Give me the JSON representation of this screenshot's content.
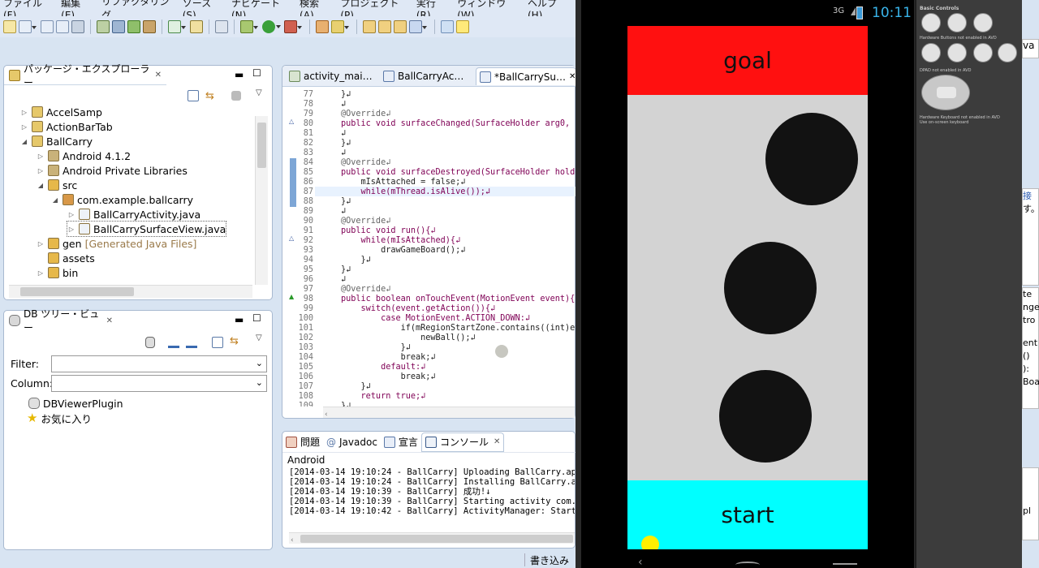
{
  "menu": [
    "ファイル(F)",
    "編集(E)",
    "リファクタリング",
    "ソース(S)",
    "ナビゲート(N)",
    "検索(A)",
    "プロジェクト(P)",
    "実行(R)",
    "ウィンドウ(W)",
    "ヘルプ(H)"
  ],
  "package_explorer": {
    "title": "パッケージ・エクスプローラー",
    "items": [
      {
        "label": "AccelSamp",
        "twisty": "▷"
      },
      {
        "label": "ActionBarTab",
        "twisty": "▷"
      },
      {
        "label": "BallCarry",
        "twisty": "◢"
      },
      {
        "label": "Android 4.1.2",
        "twisty": "▷"
      },
      {
        "label": "Android Private Libraries",
        "twisty": "▷"
      },
      {
        "label": "src",
        "twisty": "◢"
      },
      {
        "label": "com.example.ballcarry",
        "twisty": "◢"
      },
      {
        "label": "BallCarryActivity.java",
        "twisty": "▷"
      },
      {
        "label": "BallCarrySurfaceView.java",
        "twisty": "▷"
      },
      {
        "label": "gen",
        "twisty": "▷",
        "suffix": "[Generated Java Files]"
      },
      {
        "label": "assets",
        "twisty": ""
      },
      {
        "label": "bin",
        "twisty": "▷"
      }
    ]
  },
  "db_tree": {
    "title": "DB ツリー・ビュー",
    "filter_label": "Filter:",
    "column_label": "Column:",
    "items": [
      "DBViewerPlugin",
      "お気に入り"
    ]
  },
  "editor": {
    "tabs": [
      "activity_mai…",
      "BallCarryAc…",
      "*BallCarrySu…"
    ],
    "lines": [
      {
        "n": "77",
        "t": "}↲"
      },
      {
        "n": "78",
        "t": "↲"
      },
      {
        "n": "79",
        "t": "@Override↲"
      },
      {
        "n": "80",
        "t": "public void surfaceChanged(SurfaceHolder arg0, i"
      },
      {
        "n": "81",
        "t": "↲"
      },
      {
        "n": "82",
        "t": "}↲"
      },
      {
        "n": "83",
        "t": "↲"
      },
      {
        "n": "84",
        "t": "@Override↲"
      },
      {
        "n": "85",
        "t": "public void surfaceDestroyed(SurfaceHolder holde"
      },
      {
        "n": "86",
        "t": "    mIsAttached = false;↲"
      },
      {
        "n": "87",
        "t": "    while(mThread.isAlive());↲"
      },
      {
        "n": "88",
        "t": "}↲"
      },
      {
        "n": "89",
        "t": "↲"
      },
      {
        "n": "90",
        "t": "@Override↲"
      },
      {
        "n": "91",
        "t": "public void run(){↲"
      },
      {
        "n": "92",
        "t": "    while(mIsAttached){↲"
      },
      {
        "n": "93",
        "t": "        drawGameBoard();↲"
      },
      {
        "n": "94",
        "t": "    }↲"
      },
      {
        "n": "95",
        "t": "}↲"
      },
      {
        "n": "96",
        "t": "↲"
      },
      {
        "n": "97",
        "t": "@Override↲"
      },
      {
        "n": "98",
        "t": "public boolean onTouchEvent(MotionEvent event){↲"
      },
      {
        "n": "99",
        "t": "    switch(event.getAction()){↲"
      },
      {
        "n": "100",
        "t": "        case MotionEvent.ACTION_DOWN:↲"
      },
      {
        "n": "101",
        "t": "            if(mRegionStartZone.contains((int)ev"
      },
      {
        "n": "102",
        "t": "                newBall();↲"
      },
      {
        "n": "103",
        "t": "            }↲"
      },
      {
        "n": "104",
        "t": "            break;↲"
      },
      {
        "n": "105",
        "t": "        default:↲"
      },
      {
        "n": "106",
        "t": "            break;↲"
      },
      {
        "n": "107",
        "t": "    }↲"
      },
      {
        "n": "108",
        "t": "    return true;↲"
      },
      {
        "n": "109",
        "t": "}↲"
      }
    ]
  },
  "bottom_tabs": [
    "問題",
    "Javadoc",
    "宣言",
    "コンソール"
  ],
  "console": {
    "title": "Android",
    "lines": [
      "[2014-03-14 19:10:24 - BallCarry] Uploading BallCarry.apk o",
      "[2014-03-14 19:10:24 - BallCarry] Installing BallCarry.apk.",
      "[2014-03-14 19:10:39 - BallCarry] 成功!↓",
      "[2014-03-14 19:10:39 - BallCarry] Starting activity com.exa",
      "[2014-03-14 19:10:42 - BallCarry] ActivityManager: Starting"
    ]
  },
  "status_right": "書き込み可",
  "emulator": {
    "time": "10:11",
    "network": "3G",
    "goal_label": "goal",
    "start_label": "start",
    "goal_color": "#ff1010",
    "start_color": "#00ffff",
    "board_color": "#d3d3d3",
    "controls": {
      "basic": "Basic Controls",
      "hw_buttons": "Hardware Buttons not enabled in AVD",
      "dpad": "DPAD not enabled in AVD",
      "hw_keyboard": "Hardware Keyboard not enabled in AVD",
      "keyboard_hint": "Use on-screen keyboard"
    }
  },
  "right_edge": [
    "va",
    "接",
    "す。",
    "te",
    "nge",
    "tro",
    "ent",
    "()",
    "):",
    "Boa",
    "pl"
  ]
}
